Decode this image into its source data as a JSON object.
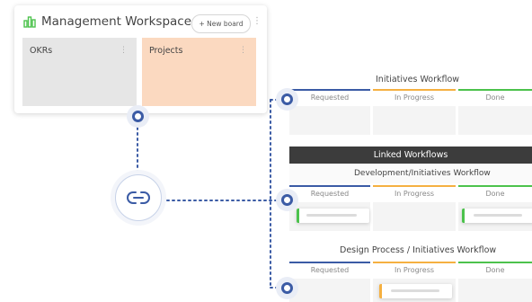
{
  "workspace": {
    "title": "Management Workspace",
    "new_board_label": "+ New board",
    "kebab": "⋮",
    "boards": [
      {
        "label": "OKRs",
        "color": "#e6e6e6",
        "menu": "⋮"
      },
      {
        "label": "Projects",
        "color": "#fbd9c0",
        "menu": "⋮"
      }
    ]
  },
  "colors": {
    "accent": "#3b5ba5",
    "requested": "#3b5ba5",
    "in_progress": "#f5b041",
    "done": "#4cc24c",
    "banner": "#3c3c3c"
  },
  "workflows": {
    "initiatives": {
      "title": "Initiatives Workflow",
      "columns": [
        "Requested",
        "In Progress",
        "Done"
      ]
    },
    "linked_banner": "Linked Workflows",
    "development": {
      "title": "Development/Initiatives Workflow",
      "columns": [
        "Requested",
        "In Progress",
        "Done"
      ]
    },
    "design": {
      "title": "Design Process / Initiatives Workflow",
      "columns": [
        "Requested",
        "In Progress",
        "Done"
      ]
    }
  },
  "icons": {
    "workspace": "chart-icon",
    "hub": "link-icon"
  }
}
